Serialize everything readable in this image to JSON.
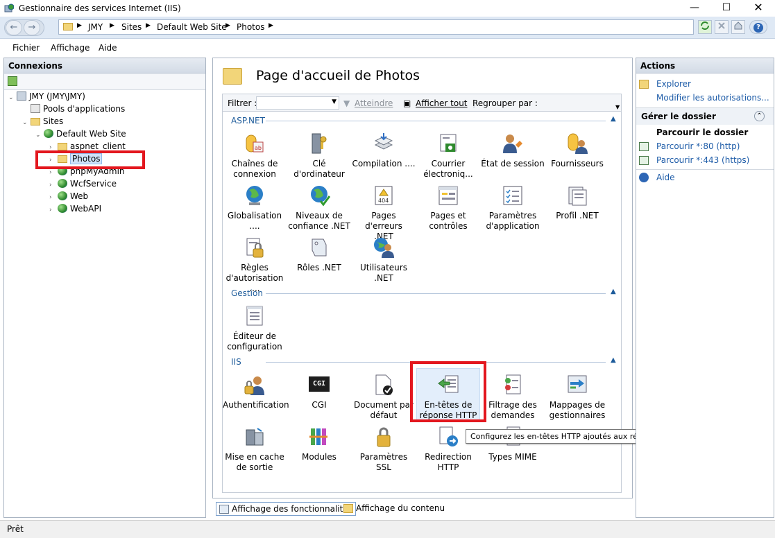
{
  "window": {
    "title": "Gestionnaire des services Internet (IIS)",
    "min_glyph": "—",
    "max_glyph": "☐",
    "close_glyph": "✕"
  },
  "address_bar": {
    "crumbs": [
      "JMY",
      "Sites",
      "Default Web Site",
      "Photos"
    ],
    "back_glyph": "←",
    "forward_glyph": "→",
    "arrow_glyph": "▶",
    "help_glyph": "?"
  },
  "menu": {
    "items": [
      "Fichier",
      "Affichage",
      "Aide"
    ]
  },
  "connections": {
    "title": "Connexions",
    "tree": [
      {
        "label": "JMY (JMY\\JMY)",
        "icon": "server-icon",
        "expander": "⌄"
      },
      {
        "label": "Pools d'applications",
        "icon": "app-pool-icon",
        "expander": ""
      },
      {
        "label": "Sites",
        "icon": "sites-folder-icon",
        "expander": "⌄"
      },
      {
        "label": "Default Web Site",
        "icon": "globe-icon",
        "expander": "⌄"
      },
      {
        "label": "aspnet_client",
        "icon": "folder-icon",
        "expander": "›"
      },
      {
        "label": "Photos",
        "icon": "folder-icon",
        "expander": "›"
      },
      {
        "label": "phpMyAdmin",
        "icon": "globe-icon",
        "expander": "›"
      },
      {
        "label": "WcfService",
        "icon": "globe-icon",
        "expander": "›"
      },
      {
        "label": "Web",
        "icon": "globe-icon",
        "expander": "›"
      },
      {
        "label": "WebAPI",
        "icon": "globe-icon",
        "expander": "›"
      }
    ]
  },
  "main": {
    "page_title": "Page d'accueil de Photos",
    "filter": {
      "label": "Filtrer :",
      "go_label": "Atteindre",
      "show_all_label": "Afficher tout",
      "group_by_label": "Regrouper par :"
    },
    "sections": {
      "aspnet": {
        "label": "ASP.NET",
        "features": [
          {
            "l1": "Chaînes de",
            "l2": "connexion",
            "icon": "connection-strings-icon"
          },
          {
            "l1": "Clé d'ordinateur",
            "l2": "",
            "icon": "machine-key-icon"
          },
          {
            "l1": "Compilation ....",
            "l2": "",
            "icon": "compilation-icon"
          },
          {
            "l1": "Courrier",
            "l2": "électroniq...",
            "icon": "smtp-mail-icon"
          },
          {
            "l1": "État de session",
            "l2": "",
            "icon": "session-state-icon"
          },
          {
            "l1": "Fournisseurs",
            "l2": "",
            "icon": "providers-icon"
          },
          {
            "l1": "Globalisation ....",
            "l2": "",
            "icon": "globalization-icon"
          },
          {
            "l1": "Niveaux de",
            "l2": "confiance .NET",
            "icon": "trust-levels-icon"
          },
          {
            "l1": "Pages d'erreurs",
            "l2": ".NET",
            "icon": "error-pages-icon"
          },
          {
            "l1": "Pages et",
            "l2": "contrôles",
            "icon": "pages-controls-icon"
          },
          {
            "l1": "Paramètres",
            "l2": "d'application",
            "icon": "app-settings-icon"
          },
          {
            "l1": "Profil .NET",
            "l2": "",
            "icon": "profile-icon"
          },
          {
            "l1": "Règles",
            "l2": "d'autorisation ....",
            "icon": "authorization-rules-icon"
          },
          {
            "l1": "Rôles .NET",
            "l2": "",
            "icon": "roles-icon"
          },
          {
            "l1": "Utilisateurs .NET",
            "l2": "",
            "icon": "users-icon"
          }
        ]
      },
      "gestion": {
        "label": "Gestion",
        "features": [
          {
            "l1": "Éditeur de",
            "l2": "configuration",
            "icon": "config-editor-icon"
          }
        ]
      },
      "iis": {
        "label": "IIS",
        "features": [
          {
            "l1": "Authentification",
            "l2": "",
            "icon": "authentication-icon"
          },
          {
            "l1": "CGI",
            "l2": "",
            "icon": "cgi-icon",
            "badge": "CGI"
          },
          {
            "l1": "Document par",
            "l2": "défaut",
            "icon": "default-document-icon"
          },
          {
            "l1": "En-têtes de",
            "l2": "réponse HTTP",
            "icon": "http-response-headers-icon"
          },
          {
            "l1": "Filtrage des",
            "l2": "demandes",
            "icon": "request-filtering-icon"
          },
          {
            "l1": "Mappages de",
            "l2": "gestionnaires",
            "icon": "handler-mappings-icon"
          },
          {
            "l1": "Mise en cache",
            "l2": "de sortie",
            "icon": "output-caching-icon"
          },
          {
            "l1": "Modules",
            "l2": "",
            "icon": "modules-icon"
          },
          {
            "l1": "Paramètres SSL",
            "l2": "",
            "icon": "ssl-settings-icon"
          },
          {
            "l1": "Redirection",
            "l2": "HTTP",
            "icon": "http-redirect-icon"
          },
          {
            "l1": "Types MIME",
            "l2": "",
            "icon": "mime-types-icon"
          }
        ]
      }
    },
    "tooltip": "Configurez les en-têtes HTTP ajoutés aux réponses du serveur Web",
    "tabs": {
      "features_view": "Affichage des fonctionnalités",
      "content_view": "Affichage du contenu"
    }
  },
  "actions": {
    "title": "Actions",
    "explore": "Explorer",
    "edit_permissions": "Modifier les autorisations...",
    "manage_folder": "Gérer le dossier",
    "browse_folder": "Parcourir le dossier",
    "browse_http": "Parcourir *:80 (http)",
    "browse_https": "Parcourir *:443 (https)",
    "help": "Aide",
    "collapse_glyph": "⌃"
  },
  "status": {
    "text": "Prêt"
  },
  "colors": {
    "highlight_red": "#e3171e",
    "link_blue": "#1e5ca8",
    "section_blue": "#1e5c9b"
  }
}
